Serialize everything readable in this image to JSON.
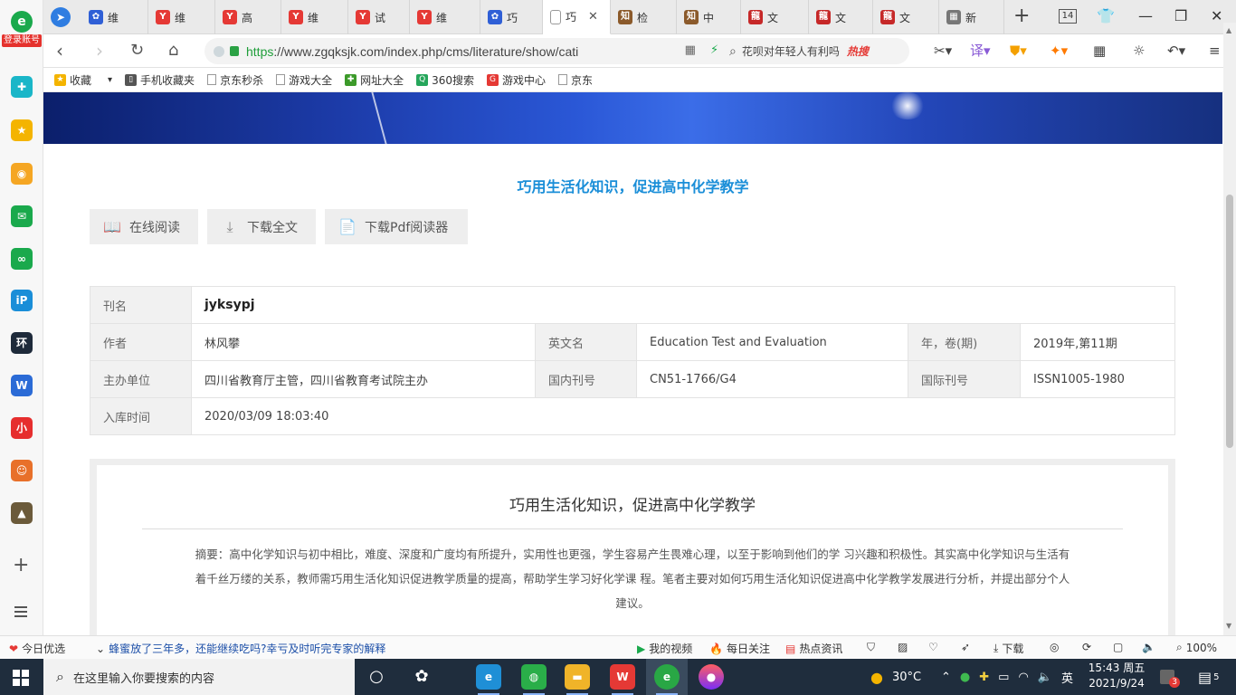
{
  "sidebar": {
    "login_label": "登录账号",
    "items": [
      {
        "icon": "chat-bubble-icon",
        "color": "#1ab6c8",
        "glyph": "✚"
      },
      {
        "icon": "star-icon",
        "color": "#f4b400",
        "glyph": "★"
      },
      {
        "icon": "weibo-icon",
        "color": "#f5a623",
        "glyph": "◉"
      },
      {
        "icon": "mail-icon",
        "color": "#1aa94c",
        "glyph": "✉"
      },
      {
        "icon": "link-icon",
        "color": "#1aa94c",
        "glyph": "∞"
      },
      {
        "icon": "ip-icon",
        "color": "#1a8ed8",
        "glyph": "iP"
      },
      {
        "icon": "news-icon",
        "color": "#1e2a3a",
        "glyph": "环"
      },
      {
        "icon": "word-icon",
        "color": "#2b6bd6",
        "glyph": "W"
      },
      {
        "icon": "redbook-icon",
        "color": "#e62e2e",
        "glyph": "小"
      },
      {
        "icon": "game-character-icon",
        "color": "#e8702a",
        "glyph": "☺"
      },
      {
        "icon": "pubg-icon",
        "color": "#6b5a3a",
        "glyph": "▲"
      }
    ]
  },
  "tabs": [
    {
      "label": "维",
      "icon": "baidu-paw-icon",
      "color": "#2f5fd6",
      "glyph": "✿"
    },
    {
      "label": "维",
      "icon": "ad-y-icon",
      "color": "#e53935",
      "glyph": "Y"
    },
    {
      "label": "高",
      "icon": "ad-y-icon",
      "color": "#e53935",
      "glyph": "Y"
    },
    {
      "label": "维",
      "icon": "ad-y-icon",
      "color": "#e53935",
      "glyph": "Y"
    },
    {
      "label": "试",
      "icon": "ad-y-icon",
      "color": "#e53935",
      "glyph": "Y"
    },
    {
      "label": "维",
      "icon": "ad-y-icon",
      "color": "#e53935",
      "glyph": "Y"
    },
    {
      "label": "巧",
      "icon": "baidu-paw-icon",
      "color": "#2f5fd6",
      "glyph": "✿"
    },
    {
      "label": "巧",
      "icon": "page-icon",
      "color": "#bbbbbb",
      "glyph": "",
      "active": true
    },
    {
      "label": "检",
      "icon": "zhi-icon",
      "color": "#8b5a2b",
      "glyph": "知"
    },
    {
      "label": "中",
      "icon": "zhi-icon",
      "color": "#8b5a2b",
      "glyph": "知"
    },
    {
      "label": "文",
      "icon": "long-icon",
      "color": "#c62828",
      "glyph": "龍"
    },
    {
      "label": "文",
      "icon": "long-icon",
      "color": "#c62828",
      "glyph": "龍"
    },
    {
      "label": "文",
      "icon": "long-icon",
      "color": "#c62828",
      "glyph": "龍"
    },
    {
      "label": "新",
      "icon": "grid-page-icon",
      "color": "#777777",
      "glyph": "▦"
    }
  ],
  "tab_count": "14",
  "address": {
    "url_scheme": "https",
    "url_rest": "://www.zgqksjk.com/index.php/cms/literature/show/cati",
    "search_placeholder": "花呗对年轻人有利吗",
    "search_hot": "热搜"
  },
  "bookmarks": [
    {
      "label": "收藏",
      "icon": "star-icon",
      "color": "#f4b400",
      "glyph": "★"
    },
    {
      "label": "手机收藏夹",
      "icon": "phone-icon",
      "color": "#555555",
      "glyph": "▯"
    },
    {
      "label": "京东秒杀",
      "icon": "page-icon",
      "color": "",
      "glyph": ""
    },
    {
      "label": "游戏大全",
      "icon": "page-icon",
      "color": "",
      "glyph": ""
    },
    {
      "label": "网址大全",
      "icon": "site-nav-icon",
      "color": "#3c9a2a",
      "glyph": "✚"
    },
    {
      "label": "360搜索",
      "icon": "search-360-icon",
      "color": "#26a65b",
      "glyph": "Q"
    },
    {
      "label": "游戏中心",
      "icon": "game-center-icon",
      "color": "#e53935",
      "glyph": "G"
    },
    {
      "label": "京东",
      "icon": "page-icon",
      "color": "",
      "glyph": ""
    }
  ],
  "article": {
    "title": "巧用生活化知识，促进高中化学教学",
    "actions": [
      {
        "label": "在线阅读",
        "icon": "book-icon"
      },
      {
        "label": "下载全文",
        "icon": "download-icon"
      },
      {
        "label": "下载Pdf阅读器",
        "icon": "pdf-icon"
      }
    ],
    "info": {
      "journal_label": "刊名",
      "journal": "jyksypj",
      "author_label": "作者",
      "author": "林风攀",
      "en_name_label": "英文名",
      "en_name": "Education Test and Evaluation",
      "issue_label": "年，卷(期)",
      "issue": "2019年,第11期",
      "sponsor_label": "主办单位",
      "sponsor": "四川省教育厅主管，四川省教育考试院主办",
      "cn_label": "国内刊号",
      "cn": "CN51-1766/G4",
      "issn_label": "国际刊号",
      "issn": "ISSN1005-1980",
      "stored_label": "入库时间",
      "stored": "2020/03/09 18:03:40"
    },
    "abstract_title": "巧用生活化知识，促进高中化学教学",
    "abstract_lines": [
      "摘要：高中化学知识与初中相比，难度、深度和广度均有所提升，实用性也更强，学生容易产生畏难心理，以至于影响到他们的学 习兴趣和积极性。其实高中化学知识与生活有",
      "着千丝万缕的关系，教师需巧用生活化知识促进教学质量的提高，帮助学生学习好化学课 程。笔者主要对如何巧用生活化知识促进高中化学教学发展进行分析，并提出部分个人",
      "建议。"
    ]
  },
  "statusbar": {
    "today": "今日优选",
    "news": "蜂蜜放了三年多，还能继续吃吗?幸亏及时听完专家的解释",
    "my_video": "我的视频",
    "daily": "每日关注",
    "hot_news": "热点资讯",
    "download": "下载",
    "zoom": "100%"
  },
  "taskbar": {
    "search_placeholder": "在这里输入你要搜索的内容",
    "temperature": "30°C",
    "ime": "英",
    "time": "15:43 周五",
    "date": "2021/9/24",
    "notif_badge": "3",
    "notif_count": "5"
  }
}
